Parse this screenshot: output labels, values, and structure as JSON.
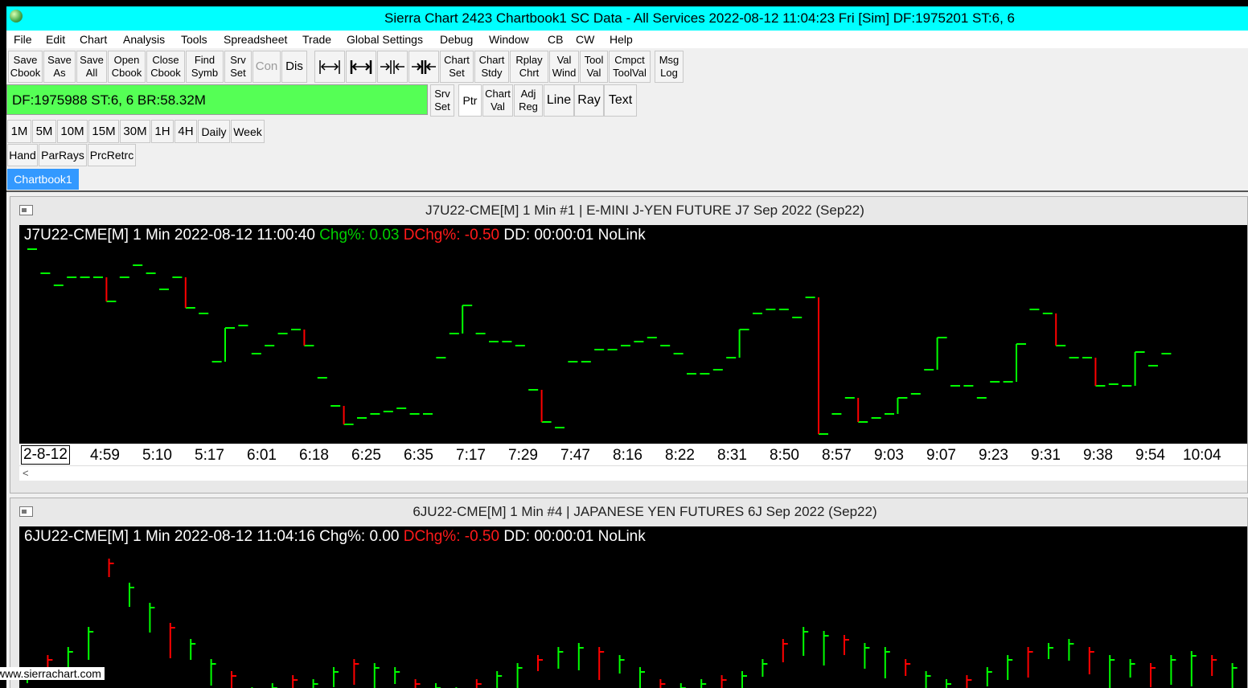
{
  "window": {
    "title": "Sierra Chart 2423 Chartbook1  SC Data - All Services 2022-08-12  11:04:23 Fri [Sim]  DF:1975201  ST:6, 6"
  },
  "menu": [
    "File",
    "Edit",
    "Chart",
    "Analysis",
    "Tools",
    "Spreadsheet",
    "Trade",
    "Global Settings",
    "Debug",
    "Window",
    "CB",
    "CW",
    "Help"
  ],
  "toolbar1": [
    {
      "l1": "Save",
      "l2": "Cbook"
    },
    {
      "l1": "Save",
      "l2": "As"
    },
    {
      "l1": "Save",
      "l2": "All"
    },
    {
      "l1": "Open",
      "l2": "Cbook"
    },
    {
      "l1": "Close",
      "l2": "Cbook"
    },
    {
      "l1": "Find",
      "l2": "Symb"
    },
    {
      "l1": "Srv",
      "l2": "Set"
    },
    {
      "l1": "Con",
      "l2": ""
    },
    {
      "l1": "Dis",
      "l2": ""
    },
    {
      "l1": "Chart",
      "l2": "Set"
    },
    {
      "l1": "Chart",
      "l2": "Stdy"
    },
    {
      "l1": "Rplay",
      "l2": "Chrt"
    },
    {
      "l1": "Val",
      "l2": "Wind"
    },
    {
      "l1": "Tool",
      "l2": "Val"
    },
    {
      "l1": "Cmpct",
      "l2": "ToolVal"
    },
    {
      "l1": "Msg",
      "l2": "Log"
    }
  ],
  "status": "DF:1975988  ST:6, 6  BR:58.32M",
  "toolbar2": [
    {
      "l1": "Srv",
      "l2": "Set"
    },
    {
      "l1": "Ptr",
      "l2": ""
    },
    {
      "l1": "Chart",
      "l2": "Val"
    },
    {
      "l1": "Adj",
      "l2": "Reg"
    },
    {
      "l1": "Line",
      "l2": ""
    },
    {
      "l1": "Ray",
      "l2": ""
    },
    {
      "l1": "Text",
      "l2": ""
    }
  ],
  "timeframes": [
    "1M",
    "5M",
    "10M",
    "15M",
    "30M",
    "1H",
    "4H",
    "Daily",
    "Week"
  ],
  "drawing_tools": [
    "Hand",
    "ParRays",
    "PrcRetrc"
  ],
  "chartbook_tab": "Chartbook1",
  "chart1": {
    "window_title": "J7U22-CME[M]  1 Min   #1 | E-MINI J-YEN FUTURE J7 Sep 2022 (Sep22)",
    "header_prefix": "J7U22-CME[M] 1 Min  2022-08-12 11:00:40 ",
    "chg": "Chg%: 0.03",
    "dchg": "DChg%: -0.50",
    "header_suffix": " DD: 00:00:01 NoLink",
    "x_labels": [
      "2-8-12",
      "4:59",
      "5:10",
      "5:17",
      "6:01",
      "6:18",
      "6:25",
      "6:35",
      "7:17",
      "7:29",
      "7:47",
      "8:16",
      "8:22",
      "8:31",
      "8:50",
      "8:57",
      "9:03",
      "9:07",
      "9:23",
      "9:31",
      "9:38",
      "9:54",
      "10:04"
    ]
  },
  "chart2": {
    "window_title": "6JU22-CME[M]  1 Min   #4 | JAPANESE YEN FUTURES 6J Sep 2022 (Sep22)",
    "header_prefix": "6JU22-CME[M] 1 Min  2022-08-12 11:04:16 Chg%: 0.00 ",
    "dchg": "DChg%: -0.50",
    "header_suffix": " DD: 00:00:01 NoLink"
  },
  "colors": {
    "up": "#00ff00",
    "down": "#ff0000",
    "title_cyan": "#00ffff",
    "status_green": "#55ff55",
    "tab_blue": "#3399ff"
  },
  "watermark": "www.sierrachart.com"
}
